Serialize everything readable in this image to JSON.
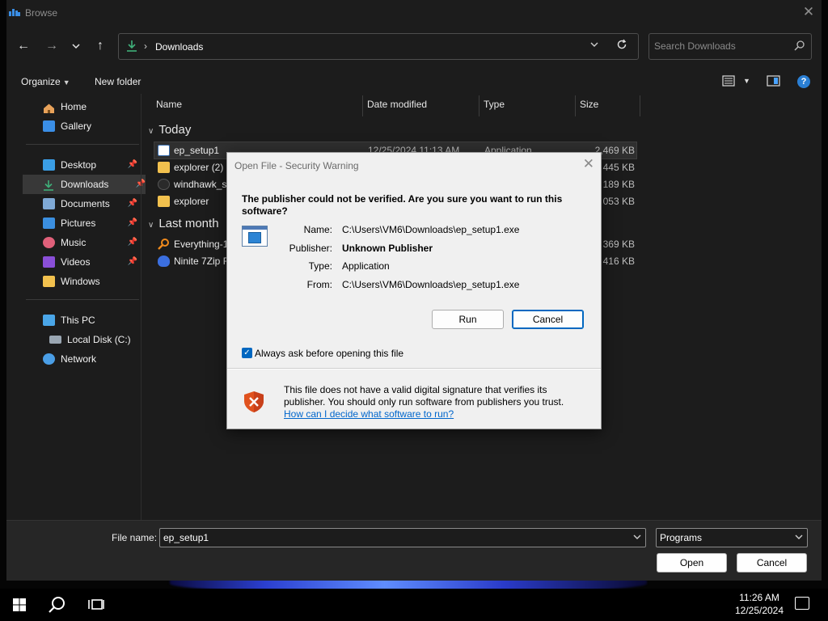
{
  "window": {
    "title": "Browse"
  },
  "nav": {
    "back": "←",
    "forward": "→",
    "recent": "⌄",
    "up": "↑",
    "breadcrumb": [
      "Downloads"
    ],
    "search_placeholder": "Search Downloads"
  },
  "toolbar": {
    "organize": "Organize",
    "new_folder": "New folder",
    "help": "?"
  },
  "sidebar": {
    "items": [
      {
        "label": "Home",
        "icon": "home-icon",
        "pinned": false
      },
      {
        "label": "Gallery",
        "icon": "gallery-icon",
        "pinned": false
      },
      {
        "label": "Desktop",
        "icon": "desktop-icon",
        "pinned": true
      },
      {
        "label": "Downloads",
        "icon": "download-icon",
        "pinned": true,
        "active": true
      },
      {
        "label": "Documents",
        "icon": "documents-icon",
        "pinned": true
      },
      {
        "label": "Pictures",
        "icon": "pictures-icon",
        "pinned": true
      },
      {
        "label": "Music",
        "icon": "music-icon",
        "pinned": true
      },
      {
        "label": "Videos",
        "icon": "videos-icon",
        "pinned": true
      },
      {
        "label": "Windows",
        "icon": "folder-icon",
        "pinned": false
      },
      {
        "label": "This PC",
        "icon": "pc-icon",
        "pinned": false
      },
      {
        "label": "Local Disk (C:)",
        "icon": "disk-icon",
        "pinned": false
      },
      {
        "label": "Network",
        "icon": "network-icon",
        "pinned": false
      }
    ]
  },
  "columns": {
    "name": "Name",
    "date": "Date modified",
    "type": "Type",
    "size": "Size"
  },
  "groups": {
    "today": "Today",
    "last_month": "Last month"
  },
  "files_today": [
    {
      "name": "ep_setup1",
      "date": "12/25/2024 11:13 AM",
      "type": "Application",
      "size": "2,469 KB"
    },
    {
      "name": "explorer (2)",
      "date": "",
      "type": "",
      "size": "445 KB"
    },
    {
      "name": "windhawk_set",
      "date": "",
      "type": "",
      "size": "189 KB"
    },
    {
      "name": "explorer",
      "date": "",
      "type": "",
      "size": "053 KB"
    }
  ],
  "files_last_month": [
    {
      "name": "Everything-1.4",
      "date": "",
      "type": "",
      "size": "369 KB"
    },
    {
      "name": "Ninite 7Zip Fir",
      "date": "",
      "type": "",
      "size": "416 KB"
    }
  ],
  "bottom": {
    "file_name_label": "File name:",
    "file_name_value": "ep_setup1",
    "file_type": "Programs",
    "open": "Open",
    "cancel": "Cancel"
  },
  "dialog": {
    "title": "Open File - Security Warning",
    "heading": "The publisher could not be verified.  Are you sure you want to run this software?",
    "fields": [
      {
        "label": "Name:",
        "value": "C:\\Users\\VM6\\Downloads\\ep_setup1.exe",
        "bold": false
      },
      {
        "label": "Publisher:",
        "value": "Unknown Publisher",
        "bold": true
      },
      {
        "label": "Type:",
        "value": "Application",
        "bold": false
      },
      {
        "label": "From:",
        "value": "C:\\Users\\VM6\\Downloads\\ep_setup1.exe",
        "bold": false
      }
    ],
    "run": "Run",
    "cancel": "Cancel",
    "checkbox_label": "Always ask before opening this file",
    "checkbox_checked": true,
    "warning": "This file does not have a valid digital signature that verifies its publisher.  You should only run software from publishers you trust.",
    "link": "How can I decide what software to run?"
  },
  "taskbar": {
    "time": "11:26 AM",
    "date": "12/25/2024"
  },
  "colors": {
    "accent": "#0067c0",
    "link": "#0066cc",
    "shield": "#e0521e",
    "folder": "#f2c14e"
  }
}
